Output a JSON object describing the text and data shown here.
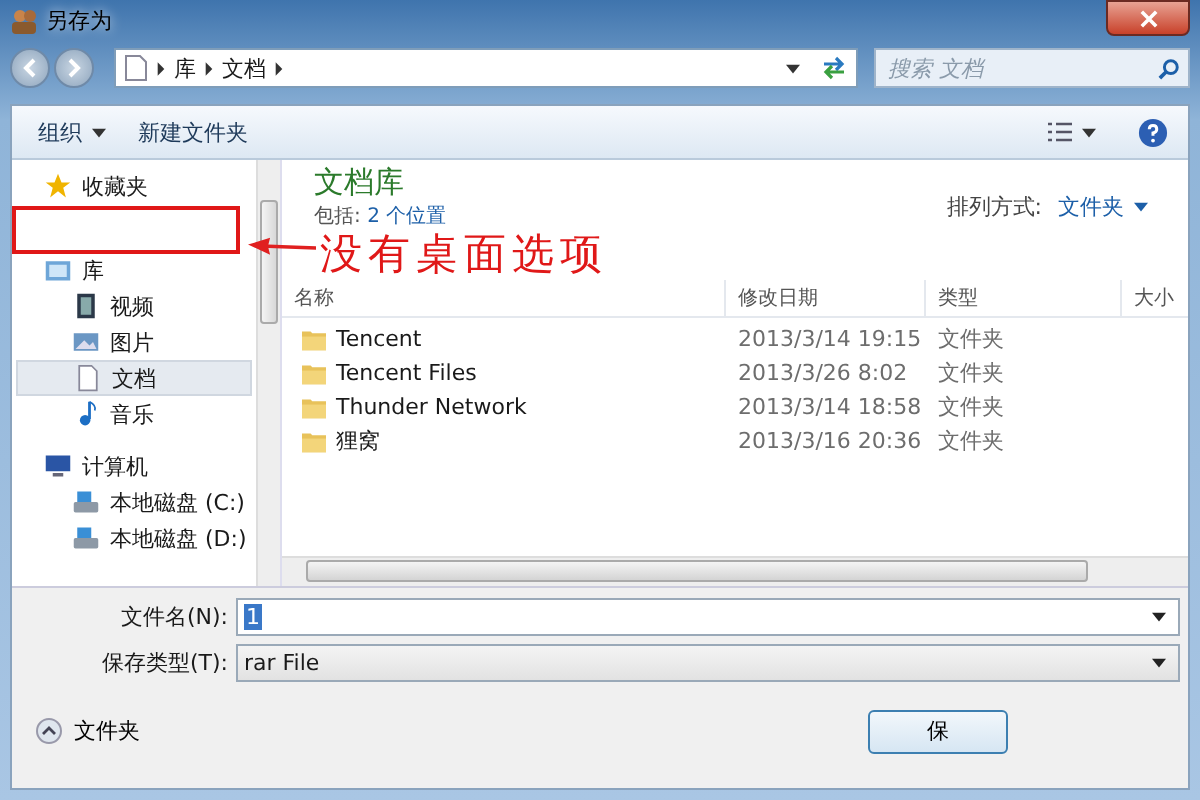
{
  "window": {
    "title": "另存为"
  },
  "address": {
    "path": [
      "库",
      "文档"
    ],
    "search_placeholder": "搜索 文档"
  },
  "toolbar": {
    "organize": "组织",
    "new_folder": "新建文件夹"
  },
  "nav": [
    {
      "kind": "group",
      "label": "收藏夹",
      "selected": false
    },
    {
      "kind": "group",
      "label": "库",
      "selected": false
    },
    {
      "kind": "item",
      "label": "视频",
      "selected": false
    },
    {
      "kind": "item",
      "label": "图片",
      "selected": false
    },
    {
      "kind": "item",
      "label": "文档",
      "selected": true
    },
    {
      "kind": "item",
      "label": "音乐",
      "selected": false
    },
    {
      "kind": "group",
      "label": "计算机",
      "selected": false
    },
    {
      "kind": "item",
      "label": "本地磁盘 (C:)",
      "selected": false
    },
    {
      "kind": "item",
      "label": "本地磁盘 (D:)",
      "selected": false
    }
  ],
  "library": {
    "title": "文档库",
    "includes_label": "包括:",
    "includes_link": "2 个位置",
    "arrange_label": "排列方式:",
    "arrange_value": "文件夹"
  },
  "columns": [
    "名称",
    "修改日期",
    "类型",
    "大小"
  ],
  "rows": [
    {
      "name": "Tencent",
      "date": "2013/3/14 19:15",
      "type": "文件夹"
    },
    {
      "name": "Tencent Files",
      "date": "2013/3/26 8:02",
      "type": "文件夹"
    },
    {
      "name": "Thunder Network",
      "date": "2013/3/14 18:58",
      "type": "文件夹"
    },
    {
      "name": "狸窝",
      "date": "2013/3/16 20:36",
      "type": "文件夹"
    }
  ],
  "file_name": {
    "label": "文件名(N):",
    "value": "1"
  },
  "file_type": {
    "label": "保存类型(T):",
    "value": "rar File"
  },
  "footer": {
    "folders_toggle": "文件夹",
    "save_button": "保"
  },
  "annotation": {
    "text": "没有桌面选项"
  }
}
